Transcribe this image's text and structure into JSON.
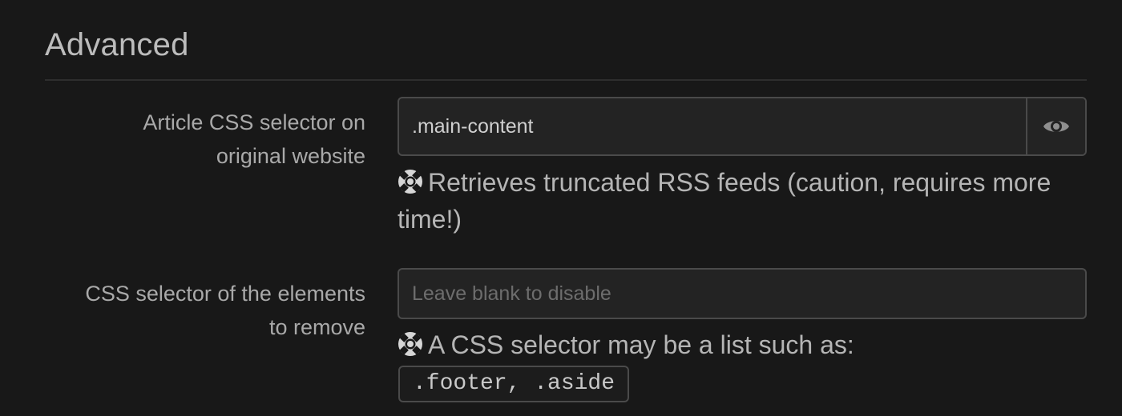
{
  "section": {
    "title": "Advanced"
  },
  "fields": [
    {
      "label_line1": "Article CSS selector on",
      "label_line2": "original website",
      "value": ".main-content",
      "placeholder": "",
      "toggle_icon": "eye-icon",
      "help_icon": "lifebuoy-icon",
      "help_text": "Retrieves truncated RSS feeds (caution, requires more time!)"
    },
    {
      "label_line1": "CSS selector of the elements",
      "label_line2": "to remove",
      "value": "",
      "placeholder": "Leave blank to disable",
      "help_icon": "lifebuoy-icon",
      "help_text": "A CSS selector may be a list such as:",
      "help_code": ".footer, .aside"
    }
  ],
  "colors": {
    "background": "#181818",
    "input_background": "#232323",
    "border": "#4a4a4a",
    "text": "#bdbdbd"
  }
}
